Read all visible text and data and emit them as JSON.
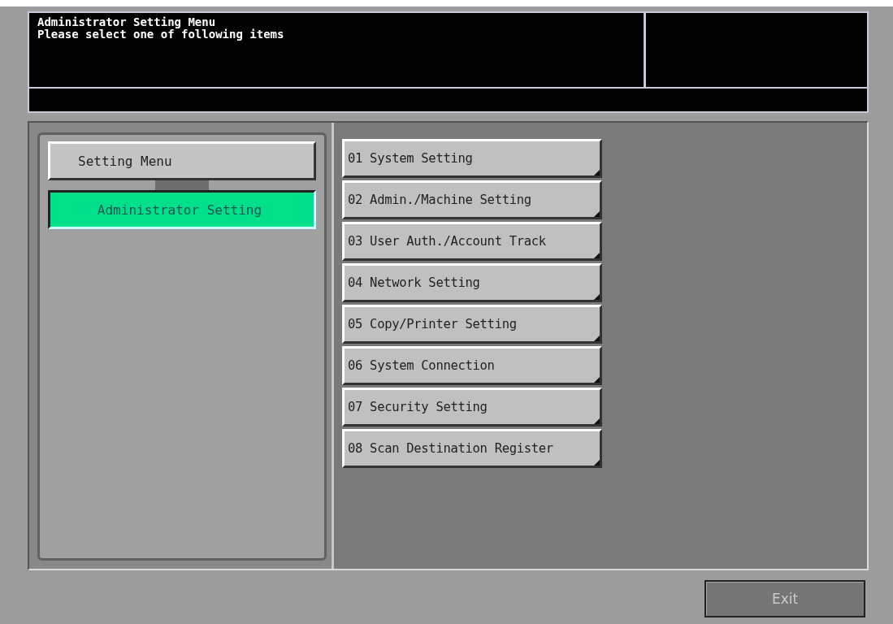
{
  "header": {
    "title": "Administrator Setting Menu",
    "message": "Please select one of following items"
  },
  "breadcrumb": [
    {
      "label": "Setting Menu",
      "selected": false
    },
    {
      "label": "Administrator Setting",
      "selected": true
    }
  ],
  "menu_items": [
    {
      "label": "01 System Setting"
    },
    {
      "label": "02 Admin./Machine Setting"
    },
    {
      "label": "03 User Auth./Account Track"
    },
    {
      "label": "04 Network Setting"
    },
    {
      "label": "05 Copy/Printer Setting"
    },
    {
      "label": "06 System Connection"
    },
    {
      "label": "07 Security Setting"
    },
    {
      "label": "08 Scan Destination Register"
    }
  ],
  "exit_button": {
    "label": "Exit",
    "disabled": true
  }
}
